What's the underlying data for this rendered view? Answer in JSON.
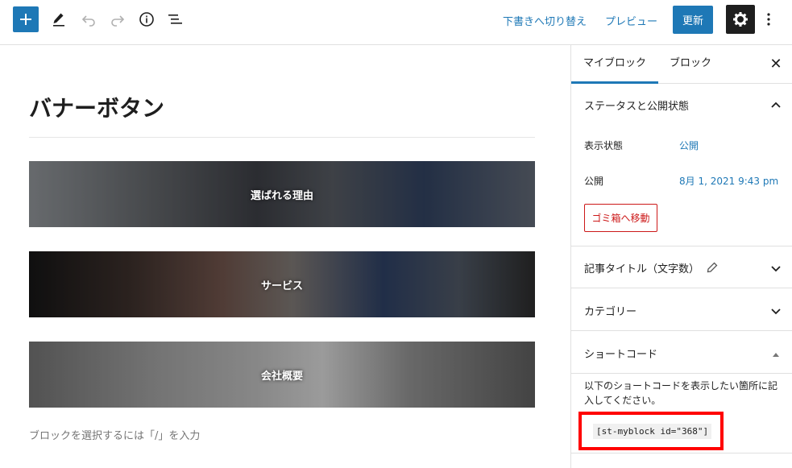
{
  "toolbar": {
    "add_icon": "plus-icon",
    "tools": [
      "pencil-icon",
      "undo-icon",
      "redo-icon",
      "info-icon",
      "list-view-icon"
    ],
    "switch_draft": "下書きへ切り替え",
    "preview": "プレビュー",
    "update": "更新",
    "settings_icon": "gear-icon",
    "more_icon": "more-vertical-icon",
    "accent_color": "#1e78b6"
  },
  "editor": {
    "title": "バナーボタン",
    "banners": [
      {
        "label": "選ばれる理由"
      },
      {
        "label": "サービス"
      },
      {
        "label": "会社概要"
      }
    ],
    "placeholder": "ブロックを選択するには「/」を入力"
  },
  "sidebar": {
    "tabs": [
      "マイブロック",
      "ブロック"
    ],
    "close_icon": "close-icon",
    "status_panel": {
      "title": "ステータスと公開状態",
      "visibility_label": "表示状態",
      "visibility_value": "公開",
      "publish_label": "公開",
      "publish_value": "8月 1, 2021 9:43 pm",
      "trash_button": "ゴミ箱へ移動"
    },
    "article_title_panel": {
      "title": "記事タイトル（文字数）"
    },
    "category_panel": {
      "title": "カテゴリー"
    },
    "shortcode_panel": {
      "title": "ショートコード",
      "description": "以下のショートコードを表示したい箇所に記入してください。",
      "code": "[st-myblock id=\"368\"]"
    },
    "highlight_color": "#ff0000"
  }
}
